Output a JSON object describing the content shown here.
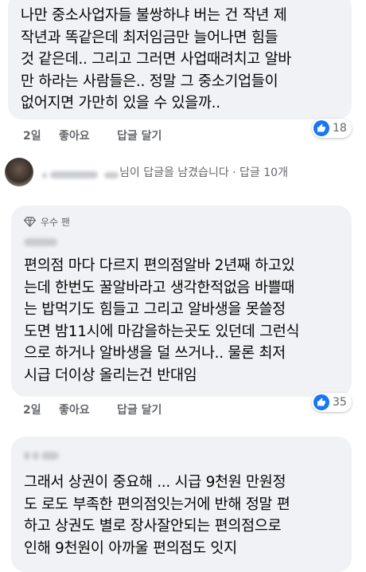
{
  "comment1": {
    "lines": [
      "나만 중소사업자들 불쌍하냐 버는 건 작년 제",
      "작년과 똑같은데 최저임금만 늘어나면 힘들",
      "것 같은데.. 그리고 그러면 사업때려치고 알바",
      "만 하라는 사람들은.. 정말 그 중소기업들이",
      "없어지면 가만히 있을 수 있을까.."
    ],
    "time": "2일",
    "like": "좋아요",
    "reply": "답글 달기",
    "reaction_count": "18"
  },
  "reply_summary": {
    "text": "님이 답글을 남겼습니다 · 답글 10개"
  },
  "comment2": {
    "badge": "우수 팬",
    "lines": [
      "편의점 마다 다르지 편의점알바 2년째 하고있",
      "는데 한번도 꿀알바라고 생각한적없음 바쁠때",
      "는 밥먹기도 힘들고 그리고 알바생을 못쓸정",
      "도면 밤11시에 마감을하는곳도 있던데 그런식",
      "으로 하거나 알바생을 덜 쓰거나.. 물론 최저",
      "시급 더이상 올리는건 반대임"
    ],
    "time": "2일",
    "like": "좋아요",
    "reply": "답글 달기",
    "reaction_count": "35"
  },
  "comment3": {
    "lines": [
      "그래서 상권이 중요해 ... 시급 9천원 만원정",
      "도 로도 부족한 편의점잇는거에 반해 정말 편",
      "하고 상권도 별로 장사잘안되는  편의점으로",
      "인해 9천원이 아까울 편의점도 잇지"
    ]
  },
  "colors": {
    "bubble": "#f0f2f5",
    "like_blue": "#1877f2",
    "meta_gray": "#65676b"
  }
}
